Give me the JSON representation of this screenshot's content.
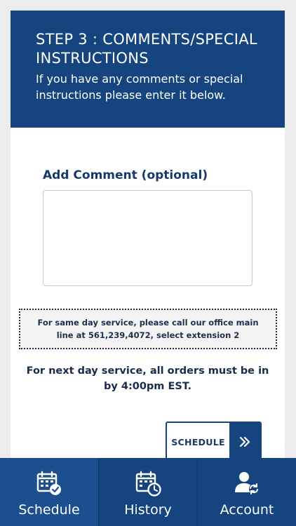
{
  "step": {
    "title": "STEP 3 : COMMENTS/SPECIAL INSTRUCTIONS",
    "description": "If you have any comments or special instructions please enter it below."
  },
  "comment": {
    "label": "Add Comment (optional)",
    "value": "",
    "placeholder": ""
  },
  "notice": {
    "text": "For same day service, please call our office main line at 561,239,4072, select extension 2"
  },
  "next_day": {
    "text": "For next day service, all orders must be in by 4:00pm EST."
  },
  "schedule_button": {
    "label": "SCHEDULE",
    "icon": "double-chevron-right-icon"
  },
  "tabs": [
    {
      "label": "Schedule",
      "icon": "calendar-check-icon"
    },
    {
      "label": "History",
      "icon": "calendar-clock-icon"
    },
    {
      "label": "Account",
      "icon": "user-refresh-icon"
    }
  ],
  "colors": {
    "primary": "#15447f",
    "text_dark": "#1a2c4a",
    "background": "#ececec"
  }
}
